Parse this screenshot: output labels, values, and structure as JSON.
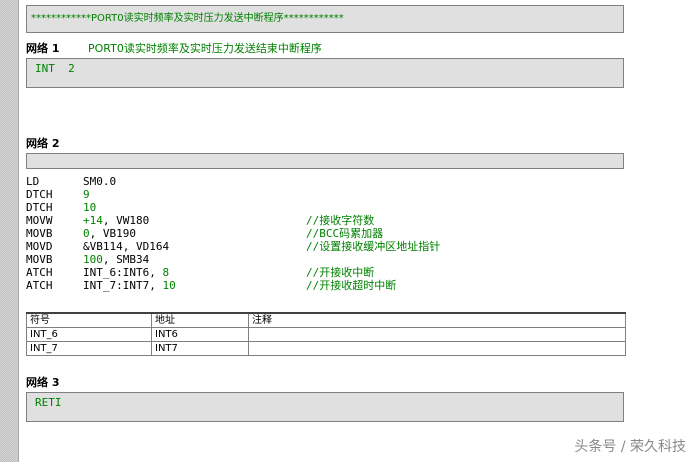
{
  "header_comment": "************PORT0读实时频率及实时压力发送中断程序************",
  "networks": [
    {
      "label": "网络 1",
      "comment": "PORT0读实时频率及实时压力发送结束中断程序",
      "code": "INT  2"
    },
    {
      "label": "网络 2",
      "comment": "",
      "lines": [
        {
          "op": "LD",
          "arg": "SM0.0",
          "arg_plain": "SM0.0",
          "arg_green": "",
          "arg_rest": "",
          "comment": ""
        },
        {
          "op": "DTCH",
          "arg": "9",
          "arg_plain": "",
          "arg_green": "9",
          "arg_rest": "",
          "comment": ""
        },
        {
          "op": "DTCH",
          "arg": "10",
          "arg_plain": "",
          "arg_green": "10",
          "arg_rest": "",
          "comment": ""
        },
        {
          "op": "MOVW",
          "arg": "+14, VW180",
          "arg_plain": "",
          "arg_green": "+14",
          "arg_rest": ", VW180",
          "comment": "//接收字符数"
        },
        {
          "op": "MOVB",
          "arg": "0, VB190",
          "arg_plain": "",
          "arg_green": "0",
          "arg_rest": ", VB190",
          "comment": "//BCC码累加器"
        },
        {
          "op": "MOVD",
          "arg": "&VB114, VD164",
          "arg_plain": "&VB114, VD164",
          "arg_green": "",
          "arg_rest": "",
          "comment": "//设置接收缓冲区地址指针"
        },
        {
          "op": "MOVB",
          "arg": "100, SMB34",
          "arg_plain": "",
          "arg_green": "100",
          "arg_rest": ", SMB34",
          "comment": ""
        },
        {
          "op": "ATCH",
          "arg": "INT_6:INT6, 8",
          "arg_plain": "INT_6:INT6, ",
          "arg_green": "8",
          "arg_rest": "",
          "comment": "//开接收中断"
        },
        {
          "op": "ATCH",
          "arg": "INT_7:INT7, 10",
          "arg_plain": "INT_7:INT7, ",
          "arg_green": "10",
          "arg_rest": "",
          "comment": "//开接收超时中断"
        }
      ]
    },
    {
      "label": "网络 3",
      "comment": "",
      "code": "RETI"
    }
  ],
  "symbol_table": {
    "headers": [
      "符号",
      "地址",
      "注释"
    ],
    "rows": [
      [
        "INT_6",
        "INT6",
        ""
      ],
      [
        "INT_7",
        "INT7",
        ""
      ]
    ]
  },
  "watermark": "头条号 / 荣久科技",
  "colors": {
    "comment_green": "#008000",
    "box_gray": "#e0e0e0",
    "border": "#808080"
  }
}
